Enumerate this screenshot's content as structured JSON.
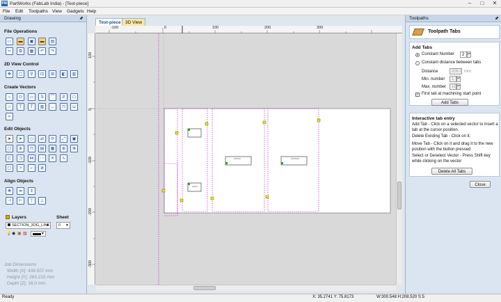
{
  "window": {
    "app_icon": "PW",
    "title": "PartWorks (FabLab India) - [Test-piece]",
    "controls": [
      "–",
      "□",
      "✕"
    ]
  },
  "menu": [
    "File",
    "Edit",
    "Toolpaths",
    "View",
    "Gadgets",
    "Help"
  ],
  "left_panel": {
    "header": "Drawing",
    "pin": "🖈",
    "sections": {
      "file_operations": "File Operations",
      "view_control": "2D View Control",
      "create_vectors": "Create Vectors",
      "edit_objects": "Edit Objects",
      "align_objects": "Align Objects"
    },
    "layers": {
      "label": "Layers",
      "sheet_label": "Sheet",
      "layer_value": "SECTION_3OG_LINE",
      "sheet_value": "0"
    },
    "job_dimensions": {
      "title": "Job Dimensions",
      "width": "Width  [X]: 438.507 mm",
      "height": "Height [Y]: 283.215 mm",
      "depth": "Depth  [Z]: 16.0 mm"
    }
  },
  "tabs": [
    {
      "label": "Test-piece",
      "active": true
    },
    {
      "label": "3D View",
      "active": false
    }
  ],
  "ruler": {
    "top_ticks": [
      "-100",
      "0",
      "100",
      "200",
      "300"
    ],
    "left_ticks": [
      "100",
      "0",
      "-100",
      "-200",
      "-300"
    ]
  },
  "right_panel": {
    "header": "Toolpaths",
    "pin": "🖈",
    "title": "Toolpath Tabs",
    "add_tabs": {
      "label": "Add Tabs",
      "constant_number": "Constant Number",
      "constant_number_value": "2",
      "constant_distance": "Constant distance between tabs",
      "distance_label": "Distance",
      "distance_value": "200.0",
      "distance_unit": "mm",
      "min_label": "Min. number",
      "min_value": "1",
      "max_label": "Max. number",
      "max_value": "10",
      "first_tab": "First tab at machining start point",
      "add_button": "Add Tabs"
    },
    "interactive": {
      "label": "Interactive tab entry",
      "add_tab_text": "Add Tab - Click on a selected vector to insert a tab at the cursor position.",
      "delete_tab_text": "Delete Existing Tab - Click on it.",
      "move_tab_text": "Move Tab - Click on it and drag it to the new position with the button pressed",
      "select_text": "Select or Deselect Vector - Press Shift key while clicking on the vector",
      "delete_all_button": "Delete All Tabs"
    },
    "close_button": "Close"
  },
  "status": {
    "left": "Ready",
    "coords": "X: 35.2741 Y: 75.8173",
    "size": "W:300.548  H:208.520  S:5"
  },
  "colors": {
    "panel_bg": "#dbe5f1",
    "tab_active": "#ffffff",
    "tab_inactive": "#f7e7a6",
    "vector_selected": "#c000c0",
    "tab_marker": "#e8e800"
  }
}
